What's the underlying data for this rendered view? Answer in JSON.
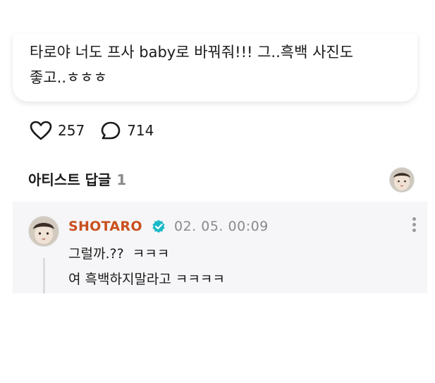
{
  "post": {
    "text_line1": "타로야 너도 프사 baby로 바꿔줘!!! 그..흑백 사진도",
    "text_line2": "좋고..ㅎㅎㅎ"
  },
  "reactions": {
    "like_count": "257",
    "comment_count": "714",
    "like_icon": "heart-outline-icon",
    "comment_icon": "speech-bubble-outline-icon"
  },
  "artist_replies": {
    "title": "아티스트 답글",
    "count": "1"
  },
  "reply": {
    "author": "SHOTARO",
    "author_color": "#c9501e",
    "verified_icon": "verified-badge-icon",
    "verified_color": "#19b9c9",
    "date": "02. 05. 00:09",
    "line1": "그럴까.??  ㅋㅋㅋ",
    "line2": "여 흑백하지말라고 ㅋㅋㅋㅋ"
  }
}
